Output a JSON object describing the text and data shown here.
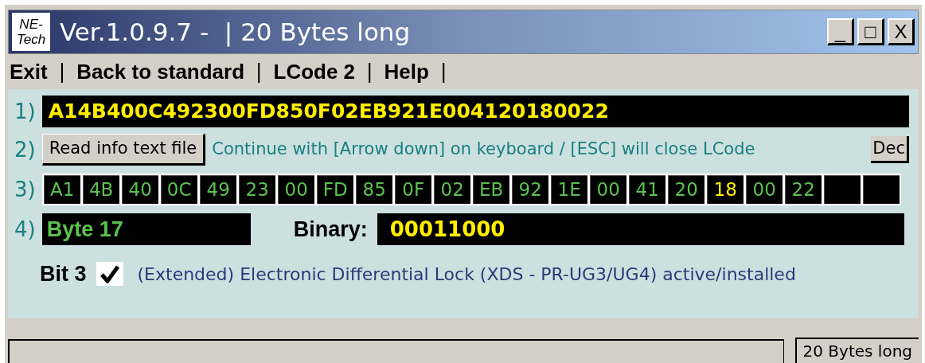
{
  "window": {
    "logo": "NE-Tech",
    "title": "Ver.1.0.9.7 -  | 20 Bytes long",
    "controls": [
      "_",
      "□",
      "X"
    ]
  },
  "menu": [
    {
      "label": "Exit",
      "separator": "|"
    },
    {
      "label": "Back to standard",
      "separator": "|"
    },
    {
      "label": "LCode 2",
      "separator": "|"
    },
    {
      "label": "Help",
      "separator": "|"
    }
  ],
  "rows": {
    "r1": {
      "label": "1)",
      "hex": "A14B400C492300FD850F02EB921E004120180022"
    },
    "r2": {
      "label": "2)",
      "button": "Read info text file",
      "hint": "Continue with [Arrow down] on keyboard / [ESC] will close LCode",
      "dec_button": "Dec"
    },
    "r3": {
      "label": "3)",
      "bytes": [
        {
          "text": "A1",
          "selected": false
        },
        {
          "text": "4B",
          "selected": false
        },
        {
          "text": "40",
          "selected": false
        },
        {
          "text": "0C",
          "selected": false
        },
        {
          "text": "49",
          "selected": false
        },
        {
          "text": "23",
          "selected": false
        },
        {
          "text": "00",
          "selected": false
        },
        {
          "text": "FD",
          "selected": false
        },
        {
          "text": "85",
          "selected": false
        },
        {
          "text": "0F",
          "selected": false
        },
        {
          "text": "02",
          "selected": false
        },
        {
          "text": "EB",
          "selected": false
        },
        {
          "text": "92",
          "selected": false
        },
        {
          "text": "1E",
          "selected": false
        },
        {
          "text": "00",
          "selected": false
        },
        {
          "text": "41",
          "selected": false
        },
        {
          "text": "20",
          "selected": false
        },
        {
          "text": "18",
          "selected": true
        },
        {
          "text": "00",
          "selected": false
        },
        {
          "text": "22",
          "selected": false
        }
      ]
    },
    "r4": {
      "label": "4)",
      "byte": "Byte 17",
      "binary_label": "Binary:",
      "binary": "00011000"
    },
    "bit": {
      "label": "Bit 3",
      "checked": true,
      "description": "(Extended) Electronic Differential Lock (XDS - PR-UG3/UG4) active/installed"
    }
  },
  "status_bar": {
    "text": "20 Bytes long"
  }
}
